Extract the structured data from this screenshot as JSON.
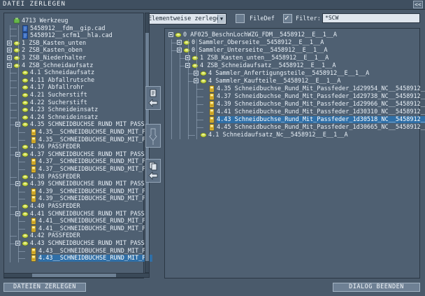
{
  "window": {
    "title": "DATEI ZERLEGEN",
    "collapse_label": "<<"
  },
  "toolbar": {
    "mode_select": "Elementweise zerlegen",
    "filedef_label": "FileDef",
    "filedef_checked": false,
    "filter_checked": true,
    "filter_label": "Filter:",
    "filter_value": "*SCW"
  },
  "left_tree": [
    {
      "label": "4713 Werkzeug",
      "level": 0,
      "icon": "root-icon",
      "toggle": false
    },
    {
      "label": "5458912__fdm__gip.cad",
      "level": 1,
      "icon": "cad-file-icon",
      "toggle": false
    },
    {
      "label": "5458912__scfm1__hla.cad",
      "level": 1,
      "icon": "cad-file-icon",
      "toggle": false
    },
    {
      "label": "1 ZSB_Kasten_unten",
      "level": 0,
      "icon": "assembly-icon",
      "toggle": true
    },
    {
      "label": "2 ZSB_Kasten_oben",
      "level": 0,
      "icon": "assembly-icon",
      "toggle": true
    },
    {
      "label": "3 ZSB_Niederhalter",
      "level": 0,
      "icon": "assembly-icon",
      "toggle": true
    },
    {
      "label": "4 ZSB_Schneidaufsatz",
      "level": 0,
      "icon": "assembly-icon",
      "toggle": true
    },
    {
      "label": "4.1 Schneidaufsatz",
      "level": 1,
      "icon": "assembly-icon",
      "toggle": false
    },
    {
      "label": "4.11 Abfallrutsche",
      "level": 1,
      "icon": "assembly-icon",
      "toggle": false
    },
    {
      "label": "4.17 Abfallrohr",
      "level": 1,
      "icon": "assembly-icon",
      "toggle": false
    },
    {
      "label": "4.21 Sucherstift",
      "level": 1,
      "icon": "assembly-icon",
      "toggle": false
    },
    {
      "label": "4.22 Sucherstift",
      "level": 1,
      "icon": "assembly-icon",
      "toggle": false
    },
    {
      "label": "4.23 Schneideinsatz",
      "level": 1,
      "icon": "assembly-icon",
      "toggle": false
    },
    {
      "label": "4.24 Schneideinsatz",
      "level": 1,
      "icon": "assembly-icon",
      "toggle": false
    },
    {
      "label": "4.35 SCHNEIDBUCHSE RUND MIT PASSF",
      "level": 1,
      "icon": "assembly-icon",
      "toggle": true
    },
    {
      "label": "4.35__SCHNEIDBUCHSE_RUND_MIT_PA",
      "level": 2,
      "icon": "part-icon",
      "toggle": false
    },
    {
      "label": "4.35__SCHNEIDBUCHSE_RUND_MIT_PA",
      "level": 2,
      "icon": "part-icon",
      "toggle": false
    },
    {
      "label": "4.36 PASSFEDER",
      "level": 1,
      "icon": "assembly-icon",
      "toggle": false
    },
    {
      "label": "4.37 SCHNEIDBUCHSE RUND MIT PASSF",
      "level": 1,
      "icon": "assembly-icon",
      "toggle": true
    },
    {
      "label": "4.37__SCHNEIDBUCHSE_RUND_MIT_PA",
      "level": 2,
      "icon": "part-icon",
      "toggle": false
    },
    {
      "label": "4.37__SCHNEIDBUCHSE_RUND_MIT_PA",
      "level": 2,
      "icon": "part-icon",
      "toggle": false
    },
    {
      "label": "4.38 PASSFEDER",
      "level": 1,
      "icon": "assembly-icon",
      "toggle": false
    },
    {
      "label": "4.39 SCHNEIDBUCHSE RUND MIT PASSF",
      "level": 1,
      "icon": "assembly-icon",
      "toggle": true
    },
    {
      "label": "4.39__SCHNEIDBUCHSE_RUND_MIT_PA",
      "level": 2,
      "icon": "part-icon",
      "toggle": false
    },
    {
      "label": "4.39__SCHNEIDBUCHSE_RUND_MIT_PA",
      "level": 2,
      "icon": "part-icon",
      "toggle": false
    },
    {
      "label": "4.40 PASSFEDER",
      "level": 1,
      "icon": "assembly-icon",
      "toggle": false
    },
    {
      "label": "4.41 SCHNEIDBUCHSE RUND MIT PASSF",
      "level": 1,
      "icon": "assembly-icon",
      "toggle": true
    },
    {
      "label": "4.41__SCHNEIDBUCHSE_RUND_MIT_PA",
      "level": 2,
      "icon": "part-icon",
      "toggle": false
    },
    {
      "label": "4.41__SCHNEIDBUCHSE_RUND_MIT_PA",
      "level": 2,
      "icon": "part-icon",
      "toggle": false
    },
    {
      "label": "4.42 PASSFEDER",
      "level": 1,
      "icon": "assembly-icon",
      "toggle": false
    },
    {
      "label": "4.43 SCHNEIDBUCHSE RUND MIT PASSF",
      "level": 1,
      "icon": "assembly-icon",
      "toggle": true
    },
    {
      "label": "4.43__SCHNEIDBUCHSE_RUND_MIT_PA",
      "level": 2,
      "icon": "part-icon",
      "toggle": false
    },
    {
      "label": "4.43__SCHNEIDBUCHSE_RUND_MIT_PA",
      "level": 2,
      "icon": "part-icon",
      "toggle": false,
      "selected": true
    }
  ],
  "right_tree": [
    {
      "label": "0 AF025_BeschnLochWZG_FDM__5458912__E__1__A",
      "level": 0,
      "icon": "assembly-icon",
      "toggle": true
    },
    {
      "label": "0 Sammler_Oberseite__5458912__E__1__A",
      "level": 1,
      "icon": "assembly-icon",
      "toggle": true
    },
    {
      "label": "0 Sammler_Unterseite__5458912__E__1__A",
      "level": 1,
      "icon": "assembly-icon",
      "toggle": true
    },
    {
      "label": "1 ZSB_Kasten_unten__5458912__E__1__A",
      "level": 2,
      "icon": "assembly-icon",
      "toggle": true
    },
    {
      "label": "4 ZSB_Schneidaufsatz__5458912__E__1__A",
      "level": 2,
      "icon": "assembly-icon",
      "toggle": true
    },
    {
      "label": "4 Sammler_Anfertigungsteile__5458912__E__1__A",
      "level": 3,
      "icon": "assembly-icon",
      "toggle": true
    },
    {
      "label": "4 Sammler_Kaufteile__5458912__E__1__A",
      "level": 3,
      "icon": "assembly-icon",
      "toggle": true
    },
    {
      "label": "4.35 Schneidbuchse_Rund_Mit_Passfeder_1d29954_NC__5458912__E",
      "level": 4,
      "icon": "part-icon",
      "toggle": false
    },
    {
      "label": "4.37 Schneidbuchse_Rund_Mit_Passfeder_1d29738_NC__5458912__E",
      "level": 4,
      "icon": "part-icon",
      "toggle": false
    },
    {
      "label": "4.39 Schneidbuchse_Rund_Mit_Passfeder_1d29966_NC__5458912__E",
      "level": 4,
      "icon": "part-icon",
      "toggle": false
    },
    {
      "label": "4.41 Schneidbuchse_Rund_Mit_Passfeder_1d30310_NC__5458912__E",
      "level": 4,
      "icon": "part-icon",
      "toggle": false
    },
    {
      "label": "4.43 Schneidbuchse_Rund_Mit_Passfeder_1d30518_NC__5458912__E",
      "level": 4,
      "icon": "part-icon",
      "toggle": false,
      "selected": true
    },
    {
      "label": "4.45 Schneidbuchse_Rund_Mit_Passfeder_1d30665_NC__5458912__E",
      "level": 4,
      "icon": "part-icon",
      "toggle": false
    },
    {
      "label": "4.1 Schneidaufsatz_Nc__5458912__E__1__A",
      "level": 3,
      "icon": "assembly-icon",
      "toggle": false
    }
  ],
  "footer": {
    "left_button": "DATEIEN ZERLEGEN",
    "right_button": "DIALOG BEENDEN"
  }
}
